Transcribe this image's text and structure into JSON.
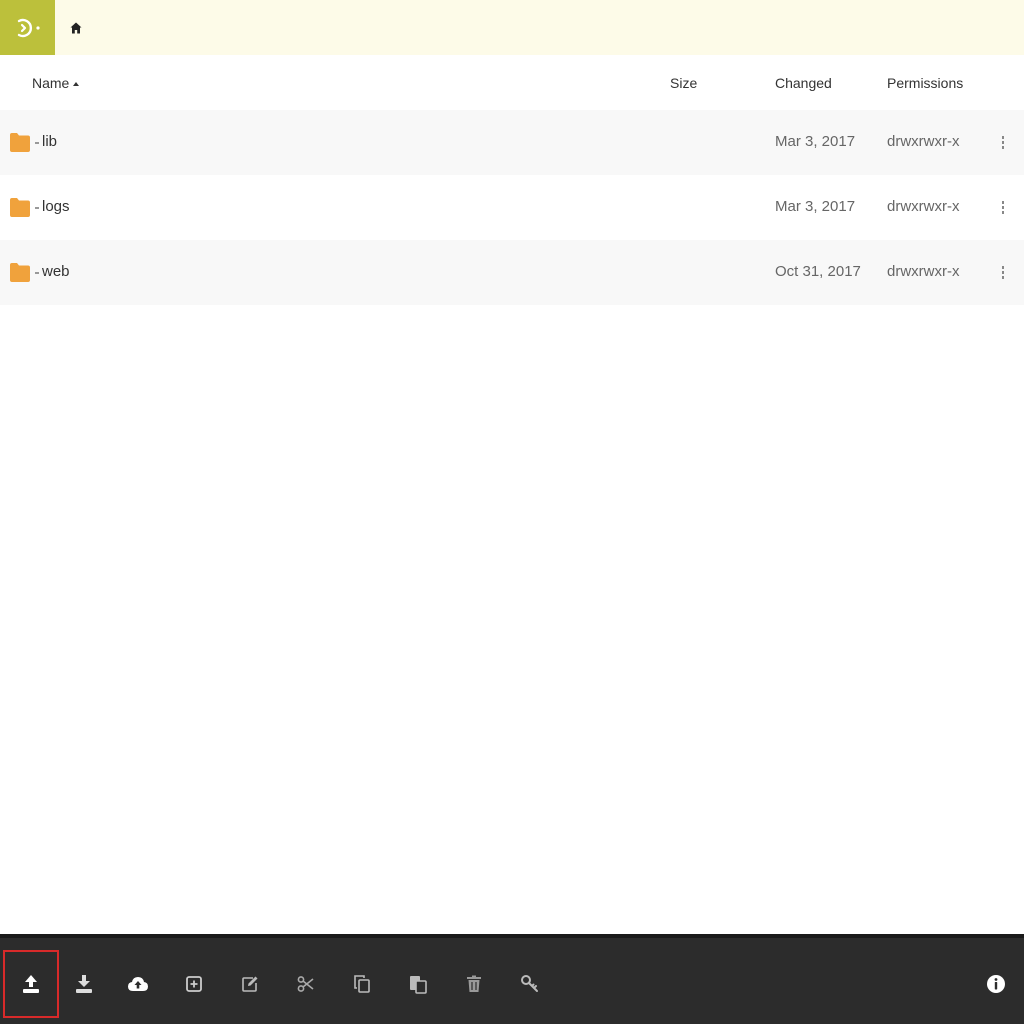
{
  "topbar": {
    "logo_icon": "app-logo-icon",
    "home_icon": "home-icon",
    "accent_color": "#bcc03b"
  },
  "table": {
    "columns": {
      "name": "Name",
      "size": "Size",
      "changed": "Changed",
      "permissions": "Permissions"
    },
    "rows": [
      {
        "name": "lib",
        "size": "",
        "changed": "Mar 3, 2017",
        "permissions": "drwxrwxr-x"
      },
      {
        "name": "logs",
        "size": "",
        "changed": "Mar 3, 2017",
        "permissions": "drwxrwxr-x"
      },
      {
        "name": "web",
        "size": "",
        "changed": "Oct 31, 2017",
        "permissions": "drwxrwxr-x"
      }
    ],
    "folder_color": "#f0a23c"
  },
  "toolbar": {
    "tools": [
      {
        "name": "upload",
        "icon": "upload-icon",
        "selected": true
      },
      {
        "name": "download",
        "icon": "download-icon"
      },
      {
        "name": "cloud-upload",
        "icon": "cloud-upload-icon"
      },
      {
        "name": "new-folder",
        "icon": "add-box-icon"
      },
      {
        "name": "edit",
        "icon": "edit-icon"
      },
      {
        "name": "cut",
        "icon": "scissors-icon"
      },
      {
        "name": "copy",
        "icon": "copy-icon"
      },
      {
        "name": "paste",
        "icon": "paste-icon"
      },
      {
        "name": "delete",
        "icon": "trash-icon"
      },
      {
        "name": "permissions",
        "icon": "key-icon"
      },
      {
        "name": "info",
        "icon": "info-icon"
      }
    ],
    "selected_outline_color": "#d82a2a"
  }
}
